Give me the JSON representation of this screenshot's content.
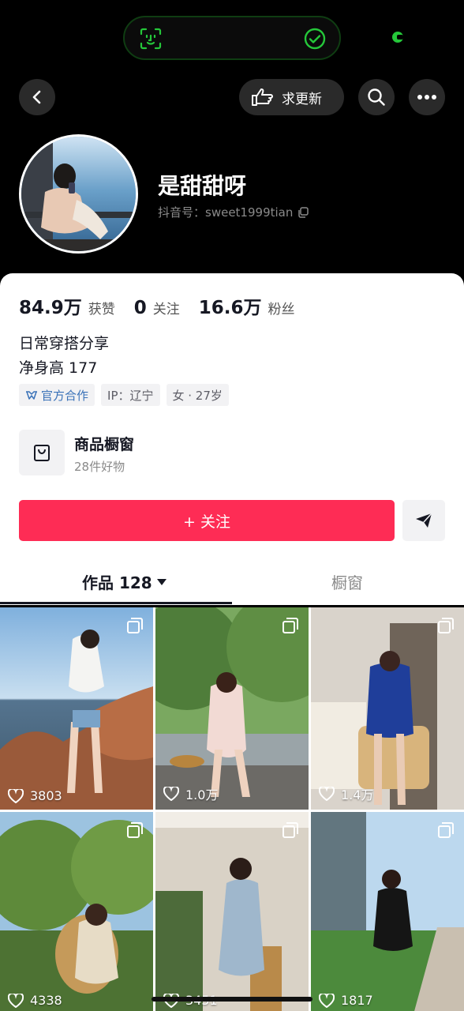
{
  "colors": {
    "accent": "#fe2c55",
    "pill_green": "#25c73a",
    "tag_blue": "#3a72b8"
  },
  "top_bar": {
    "request_update_label": "求更新",
    "icons": [
      "back-icon",
      "hand-point-icon",
      "search-icon",
      "more-icon"
    ]
  },
  "profile": {
    "name": "是甜甜呀",
    "douyin_id_label": "抖音号：",
    "douyin_id": "sweet1999tian"
  },
  "stats": [
    {
      "value": "84.9万",
      "label": "获赞"
    },
    {
      "value": "0",
      "label": "关注"
    },
    {
      "value": "16.6万",
      "label": "粉丝"
    }
  ],
  "bio": {
    "line1": "日常穿搭分享",
    "line2": "净身高 177"
  },
  "tags": {
    "official": "官方合作",
    "ip": "IP：辽宁",
    "gender_age": "女 · 27岁"
  },
  "shop": {
    "title": "商品橱窗",
    "subtitle": "28件好物"
  },
  "actions": {
    "follow_label": "+ 关注"
  },
  "tabs": {
    "works_label": "作品 128",
    "window_label": "橱窗"
  },
  "posts": [
    {
      "likes": "3803"
    },
    {
      "likes": "1.0万"
    },
    {
      "likes": "1.4万"
    },
    {
      "likes": "4338"
    },
    {
      "likes": "3451"
    },
    {
      "likes": "1817"
    }
  ]
}
